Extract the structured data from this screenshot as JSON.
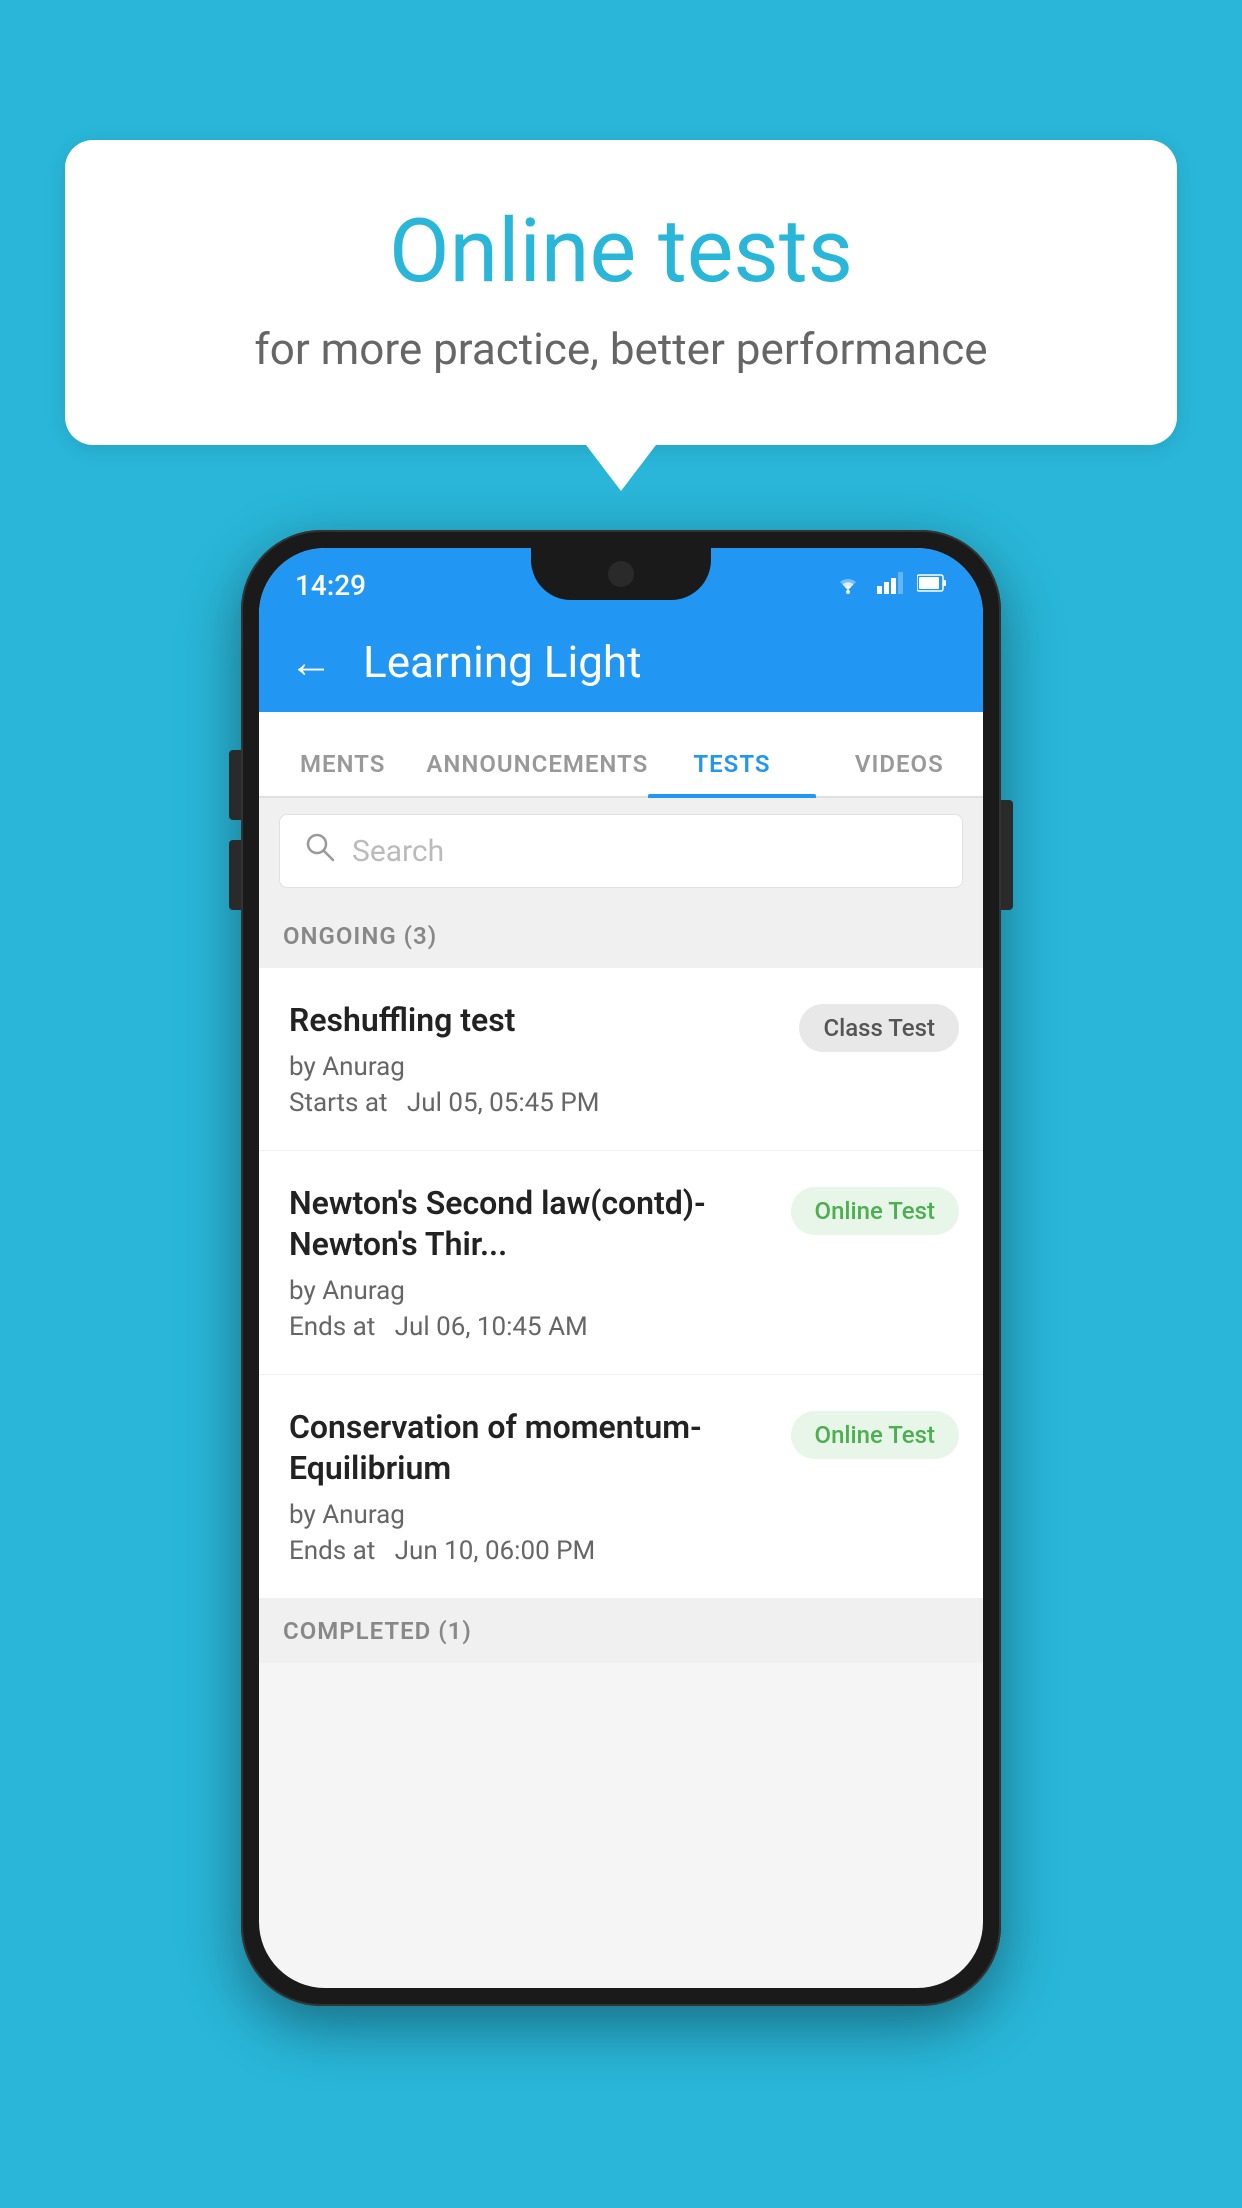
{
  "background": {
    "color": "#29B6D8"
  },
  "speech_bubble": {
    "title": "Online tests",
    "subtitle": "for more practice, better performance"
  },
  "phone": {
    "status_bar": {
      "time": "14:29",
      "wifi": "▾",
      "signal": "▲",
      "battery": "▮"
    },
    "app_bar": {
      "back_label": "←",
      "title": "Learning Light"
    },
    "tabs": [
      {
        "label": "MENTS",
        "active": false
      },
      {
        "label": "ANNOUNCEMENTS",
        "active": false
      },
      {
        "label": "TESTS",
        "active": true
      },
      {
        "label": "VIDEOS",
        "active": false
      }
    ],
    "search": {
      "placeholder": "Search"
    },
    "sections": [
      {
        "header": "ONGOING (3)",
        "items": [
          {
            "name": "Reshuffling test",
            "author": "by Anurag",
            "date": "Starts at  Jul 05, 05:45 PM",
            "badge": "Class Test",
            "badge_type": "class"
          },
          {
            "name": "Newton's Second law(contd)-Newton's Thir...",
            "author": "by Anurag",
            "date": "Ends at  Jul 06, 10:45 AM",
            "badge": "Online Test",
            "badge_type": "online"
          },
          {
            "name": "Conservation of momentum-Equilibrium",
            "author": "by Anurag",
            "date": "Ends at  Jun 10, 06:00 PM",
            "badge": "Online Test",
            "badge_type": "online"
          }
        ]
      },
      {
        "header": "COMPLETED (1)",
        "items": []
      }
    ]
  }
}
